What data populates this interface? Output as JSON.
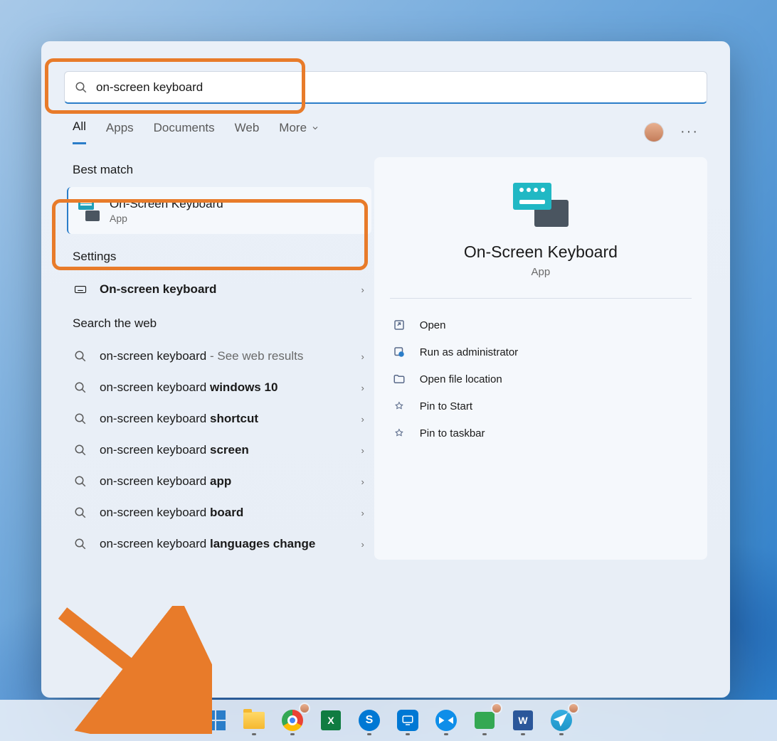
{
  "search": {
    "query": "on-screen keyboard"
  },
  "tabs": {
    "all": "All",
    "apps": "Apps",
    "documents": "Documents",
    "web": "Web",
    "more": "More"
  },
  "sections": {
    "best_match": "Best match",
    "settings": "Settings",
    "search_web": "Search the web"
  },
  "best_match": {
    "title": "On-Screen Keyboard",
    "subtitle": "App"
  },
  "settings_item": {
    "label": "On-screen keyboard"
  },
  "web_results": [
    {
      "prefix": "on-screen keyboard",
      "bold": "",
      "light": " - See web results"
    },
    {
      "prefix": "on-screen keyboard ",
      "bold": "windows 10",
      "light": ""
    },
    {
      "prefix": "on-screen keyboard ",
      "bold": "shortcut",
      "light": ""
    },
    {
      "prefix": "on-screen keyboard ",
      "bold": "screen",
      "light": ""
    },
    {
      "prefix": "on-screen keyboard ",
      "bold": "app",
      "light": ""
    },
    {
      "prefix": "on-screen keyboard ",
      "bold": "board",
      "light": ""
    },
    {
      "prefix": "on-screen keyboard ",
      "bold": "languages change",
      "light": ""
    }
  ],
  "preview": {
    "title": "On-Screen Keyboard",
    "subtitle": "App"
  },
  "actions": {
    "open": "Open",
    "run_admin": "Run as administrator",
    "open_loc": "Open file location",
    "pin_start": "Pin to Start",
    "pin_taskbar": "Pin to taskbar"
  },
  "taskbar": {
    "excel": "X",
    "skype": "S",
    "word": "W"
  }
}
